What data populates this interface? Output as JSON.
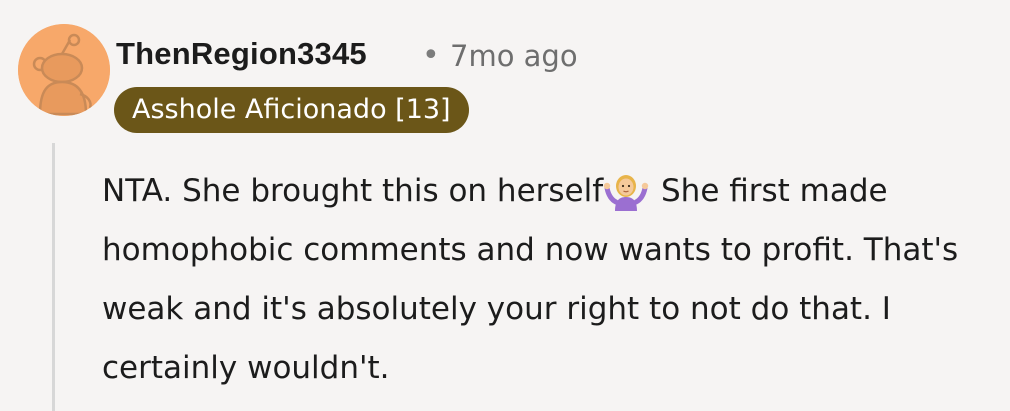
{
  "comment": {
    "username": "ThenRegion3345",
    "separator": "•",
    "timestamp": "7mo ago",
    "flair": "Asshole Aficionado [13]",
    "avatar_icon": "reddit-snoo-avatar-icon",
    "text_before_emoji": "NTA. She brought this on herself",
    "emoji": "person-shrugging-emoji",
    "text_after_emoji": " She first made homophobic comments and now wants to profit. That's weak and it's absolutely your right to not do that. I certainly wouldn't."
  },
  "colors": {
    "background": "#f6f4f3",
    "avatar": "#f7a86a",
    "flair_background": "#6b5618",
    "flair_text": "#ffffff",
    "thread_line": "#d7d7d7"
  }
}
